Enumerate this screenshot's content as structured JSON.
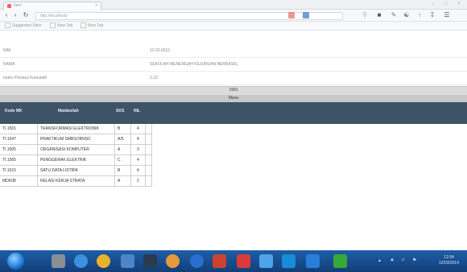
{
  "browser": {
    "tab_title": "Item",
    "tab_close": "×",
    "url": "http://localhost/",
    "window_controls": {
      "minimize": "–",
      "maximize": "□",
      "close": "×"
    },
    "bookmarks": [
      {
        "label": "Suggested Sites"
      },
      {
        "label": "New Tab"
      },
      {
        "label": "New Tab"
      }
    ]
  },
  "info": {
    "rows": [
      {
        "label": "NIM",
        "value": "12.02.0012"
      },
      {
        "label": "NAMA",
        "value": "SEKOLAH MENENGAH KEJURUAN BERBASIS"
      },
      {
        "label": "Index Prestasi Kumulatif",
        "value": "2.33"
      }
    ],
    "year_label": "1991",
    "menu_label": "Menu"
  },
  "table": {
    "headers": [
      "Kode MK",
      "Matakuliah",
      "SKS",
      "NIL"
    ],
    "rows": [
      [
        "TI.1501",
        "TRANSFORMASI ELEKTRONIK",
        "B",
        "4"
      ],
      [
        "TI.1547",
        "PRAKTIKUM SMBSORNSC",
        "A/5",
        "4"
      ],
      [
        "TI.1505",
        "ORGANISASI KOMPUTER",
        "A",
        "3"
      ],
      [
        "TI.1565",
        "PENGGERAK ELEKTRIK",
        "C",
        "4"
      ],
      [
        "TI.1515",
        "SATU DATA LISTRIK",
        "B",
        "4"
      ],
      [
        "MDK08",
        "RELASI KERJA STRATA",
        "A",
        "2"
      ]
    ]
  },
  "taskbar": {
    "clock_time": "12:34",
    "clock_date": "12/03/2014"
  },
  "colors": {
    "table_header": "#3f5368",
    "taskbar": "#1e5ea8"
  }
}
